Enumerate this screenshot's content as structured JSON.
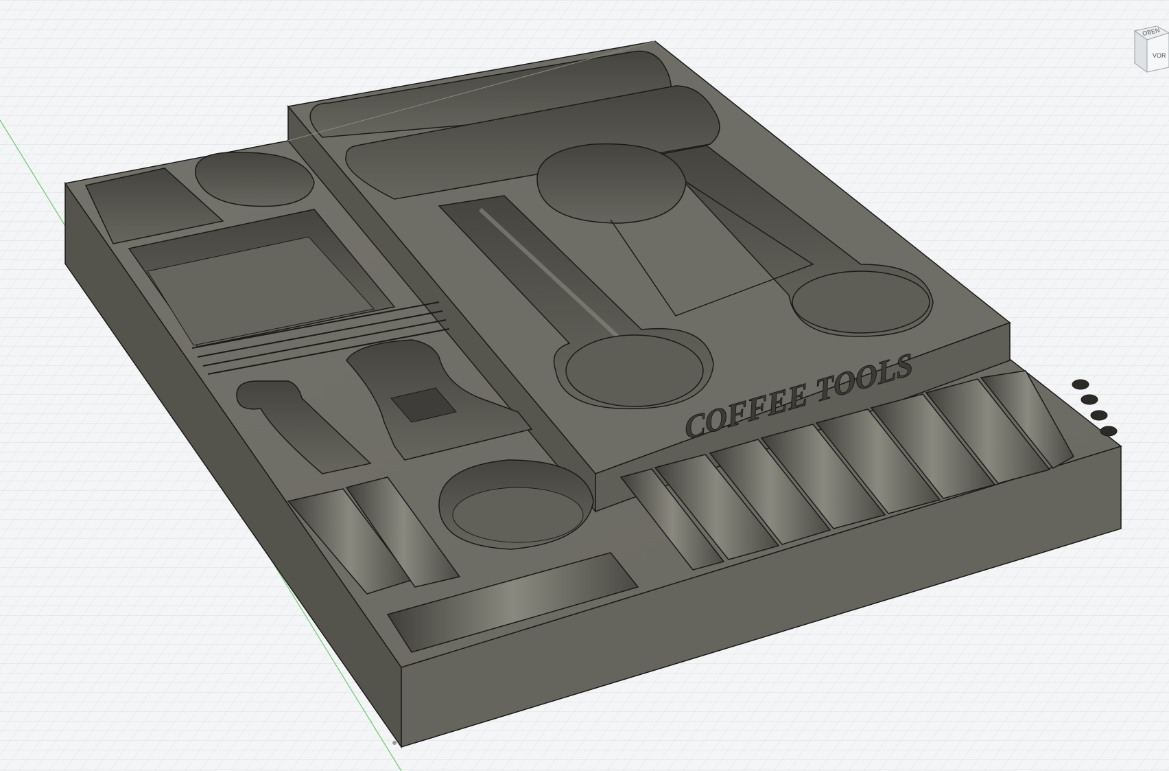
{
  "viewport": {
    "background": "#f4f5f6",
    "grid_color": "#d7d9dc",
    "grid_major_color": "#c4c7cb",
    "axis_green": "#66cc66"
  },
  "model": {
    "engraving": "COFFEE TOOLS",
    "body_top_color": "#6e6d65",
    "body_side_color": "#5b5a53",
    "body_front_color": "#66655d",
    "pocket_floor_color": "#625f58",
    "pocket_wall_color": "#4c4b45",
    "edge_color": "#1a1a18",
    "highlight_color": "#8b8a82"
  },
  "viewcube": {
    "top_label": "OBEN",
    "front_label": "VOR",
    "icon": "viewcube-icon"
  }
}
